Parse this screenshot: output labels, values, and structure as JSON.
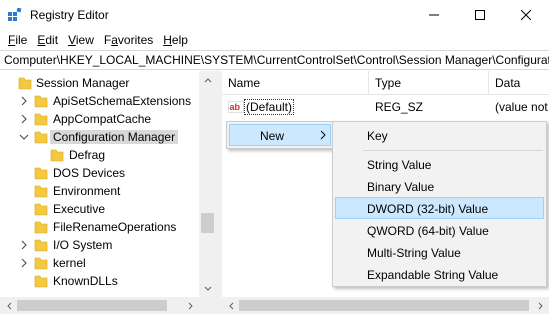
{
  "window": {
    "title": "Registry Editor",
    "controls": {
      "minimize_icon": "minimize-icon",
      "maximize_icon": "maximize-icon",
      "close_icon": "close-icon"
    }
  },
  "menubar": {
    "items": [
      {
        "accel": "F",
        "rest": "ile"
      },
      {
        "accel": "E",
        "rest": "dit"
      },
      {
        "accel": "V",
        "rest": "iew"
      },
      {
        "pre": "F",
        "accel": "a",
        "rest": "vorites"
      },
      {
        "accel": "H",
        "rest": "elp"
      }
    ]
  },
  "address": {
    "path": "Computer\\HKEY_LOCAL_MACHINE\\SYSTEM\\CurrentControlSet\\Control\\Session Manager\\Configurat"
  },
  "tree": {
    "items": [
      {
        "label": "Session Manager",
        "expanded": true
      },
      {
        "label": "ApiSetSchemaExtensions",
        "expanded": false
      },
      {
        "label": "AppCompatCache",
        "expanded": false
      },
      {
        "label": "Configuration Manager",
        "expanded": true,
        "selected": true
      },
      {
        "label": "Defrag"
      },
      {
        "label": "DOS Devices"
      },
      {
        "label": "Environment"
      },
      {
        "label": "Executive"
      },
      {
        "label": "FileRenameOperations"
      },
      {
        "label": "I/O System",
        "expanded": false
      },
      {
        "label": "kernel",
        "expanded": false
      },
      {
        "label": "KnownDLLs"
      }
    ]
  },
  "list": {
    "columns": {
      "name": "Name",
      "type": "Type",
      "data": "Data"
    },
    "rows": [
      {
        "name": "(Default)",
        "type": "REG_SZ",
        "data": "(value not set)",
        "icon": "string-value-icon"
      }
    ]
  },
  "context_menu": {
    "new_label": "New",
    "submenu": [
      {
        "label": "Key"
      },
      {
        "label": "String Value"
      },
      {
        "label": "Binary Value"
      },
      {
        "label": "DWORD (32-bit) Value",
        "highlighted": true
      },
      {
        "label": "QWORD (64-bit) Value"
      },
      {
        "label": "Multi-String Value"
      },
      {
        "label": "Expandable String Value"
      }
    ]
  },
  "colors": {
    "folder": "#f5c842",
    "highlight_bg": "#cce8ff",
    "highlight_border": "#99d1ff",
    "selection_bg": "#d9d9d9",
    "menu_bg": "#f2f2f2"
  }
}
